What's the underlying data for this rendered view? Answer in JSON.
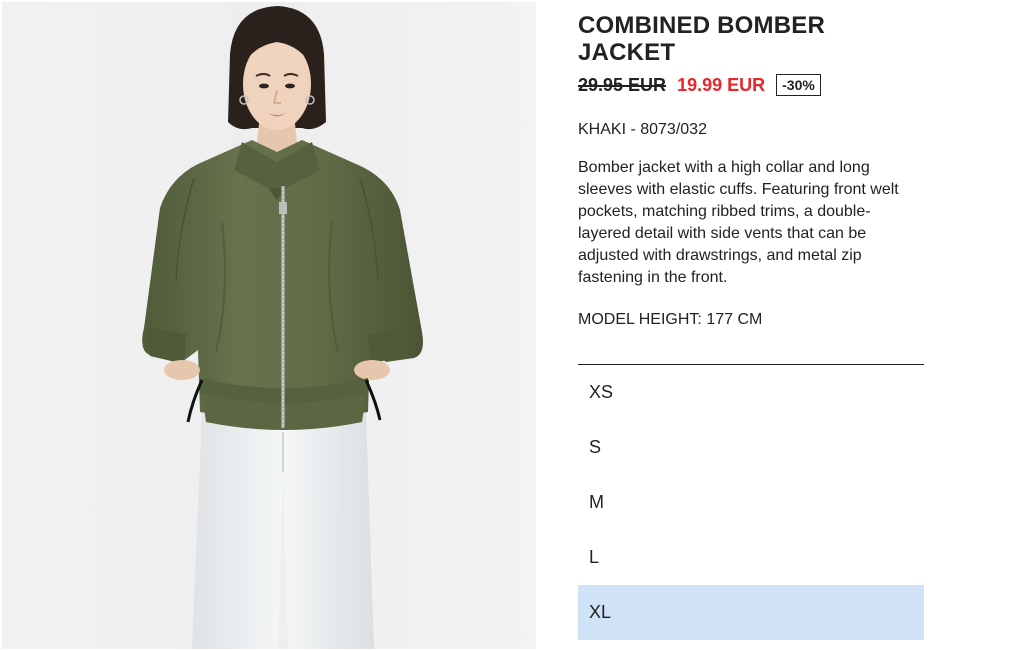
{
  "product": {
    "title": "COMBINED BOMBER JACKET",
    "old_price": "29.95 EUR",
    "new_price": "19.99 EUR",
    "discount": "-30%",
    "color_ref": "KHAKI - 8073/032",
    "description": "Bomber jacket with a high collar and long sleeves with elastic cuffs. Featuring front welt pockets, matching ribbed trims, a double-layered detail with side vents that can be adjusted with drawstrings, and metal zip fastening in the front.",
    "model_height": "MODEL HEIGHT: 177 CM"
  },
  "sizes": {
    "options": [
      "XS",
      "S",
      "M",
      "L",
      "XL"
    ],
    "selected": "XL"
  },
  "colors": {
    "sale_red": "#e8262b",
    "selected_bg": "#d0e2f5",
    "jacket_khaki": "#5d6a45"
  }
}
